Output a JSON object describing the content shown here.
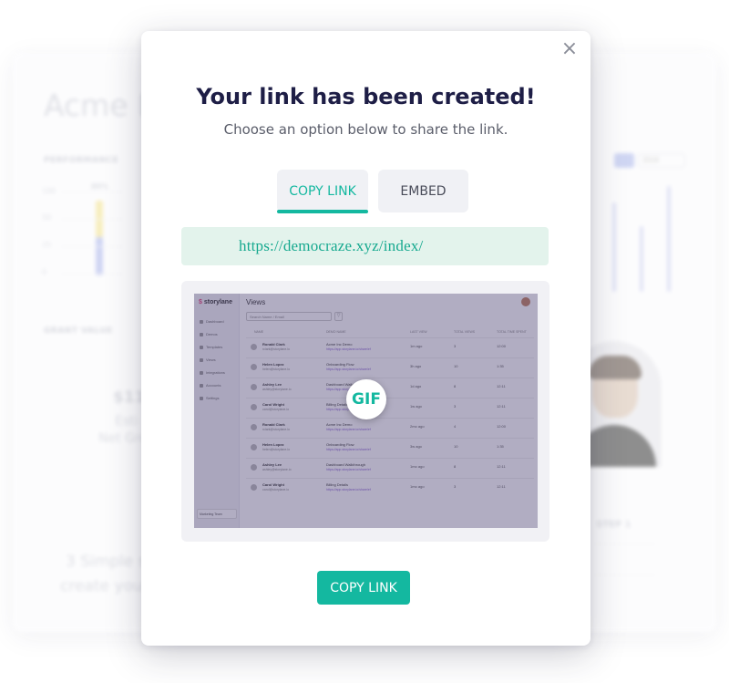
{
  "modal": {
    "close_icon": "×",
    "title": "Your link has been created!",
    "subtitle": "Choose an option below to share the link.",
    "tabs": [
      {
        "label": "COPY LINK",
        "active": true
      },
      {
        "label": "EMBED",
        "active": false
      }
    ],
    "link_url": "https://democraze.xyz/index/",
    "gif_badge": "GIF",
    "copy_button": "COPY LINK"
  },
  "preview": {
    "brand": "storylane",
    "page_title": "Views",
    "search_placeholder": "Search Name / Email",
    "nav": [
      "Dashboard",
      "Demos",
      "Templates",
      "Views",
      "Integrations",
      "Accounts",
      "Settings"
    ],
    "columns": [
      "NAME",
      "DEMO NAME",
      "LAST VIEW",
      "TOTAL VIEWS",
      "TOTAL TIME SPENT"
    ],
    "rows": [
      {
        "name": "Ronald Clark",
        "email": "rclark@storylane.io",
        "demo": "Acme Inc Demo",
        "url": "https://app.storylane.io/share/ef",
        "ago": "1m ago",
        "views": "3",
        "time": "12:00"
      },
      {
        "name": "Helen Lopez",
        "email": "helen@storylane.io",
        "demo": "Onboarding Flow",
        "url": "https://app.storylane.io/share/ef",
        "ago": "3h ago",
        "views": "10",
        "time": "1:35"
      },
      {
        "name": "Ashley Lee",
        "email": "ashley@storylane.io",
        "demo": "Dashboard Walkthrough",
        "url": "https://app.storylane.io/share/ef",
        "ago": "1d ago",
        "views": "8",
        "time": "12:11"
      },
      {
        "name": "Carol Wright",
        "email": "carol@storylane.io",
        "demo": "Billing Details",
        "url": "https://app.storylane.io/share/ef",
        "ago": "1w ago",
        "views": "3",
        "time": "12:11"
      },
      {
        "name": "Ronald Clark",
        "email": "rclark@storylane.io",
        "demo": "Acme Inc Demo",
        "url": "https://app.storylane.io/share/ef",
        "ago": "2mo ago",
        "views": "4",
        "time": "12:00"
      },
      {
        "name": "Helen Lopez",
        "email": "helen@storylane.io",
        "demo": "Onboarding Flow",
        "url": "https://app.storylane.io/share/ef",
        "ago": "3w ago",
        "views": "10",
        "time": "1:35"
      },
      {
        "name": "Ashley Lee",
        "email": "ashley@storylane.io",
        "demo": "Dashboard Walkthrough",
        "url": "https://app.storylane.io/share/ef",
        "ago": "1mo ago",
        "views": "8",
        "time": "12:11"
      },
      {
        "name": "Carol Wright",
        "email": "carol@storylane.io",
        "demo": "Billing Details",
        "url": "https://app.storylane.io/share/ef",
        "ago": "1mo ago",
        "views": "3",
        "time": "12:11"
      }
    ],
    "team": "Marketing Team"
  },
  "background": {
    "title": "Acme D",
    "performance_label": "PERFORMANCE",
    "grant_label": "GRANT VALUE",
    "percent": "80%",
    "y_ticks": [
      "100",
      "50",
      "25",
      "0"
    ],
    "amount": "$115",
    "est": "Esti",
    "net": "Net Gro",
    "promo_line1": "3 Simple ste",
    "promo_line2": "create your",
    "step": "STEP 1",
    "year": "2018"
  },
  "colors": {
    "accent": "#14b8a0",
    "title": "#1e1e46",
    "link_bg": "#e3f3ec"
  }
}
